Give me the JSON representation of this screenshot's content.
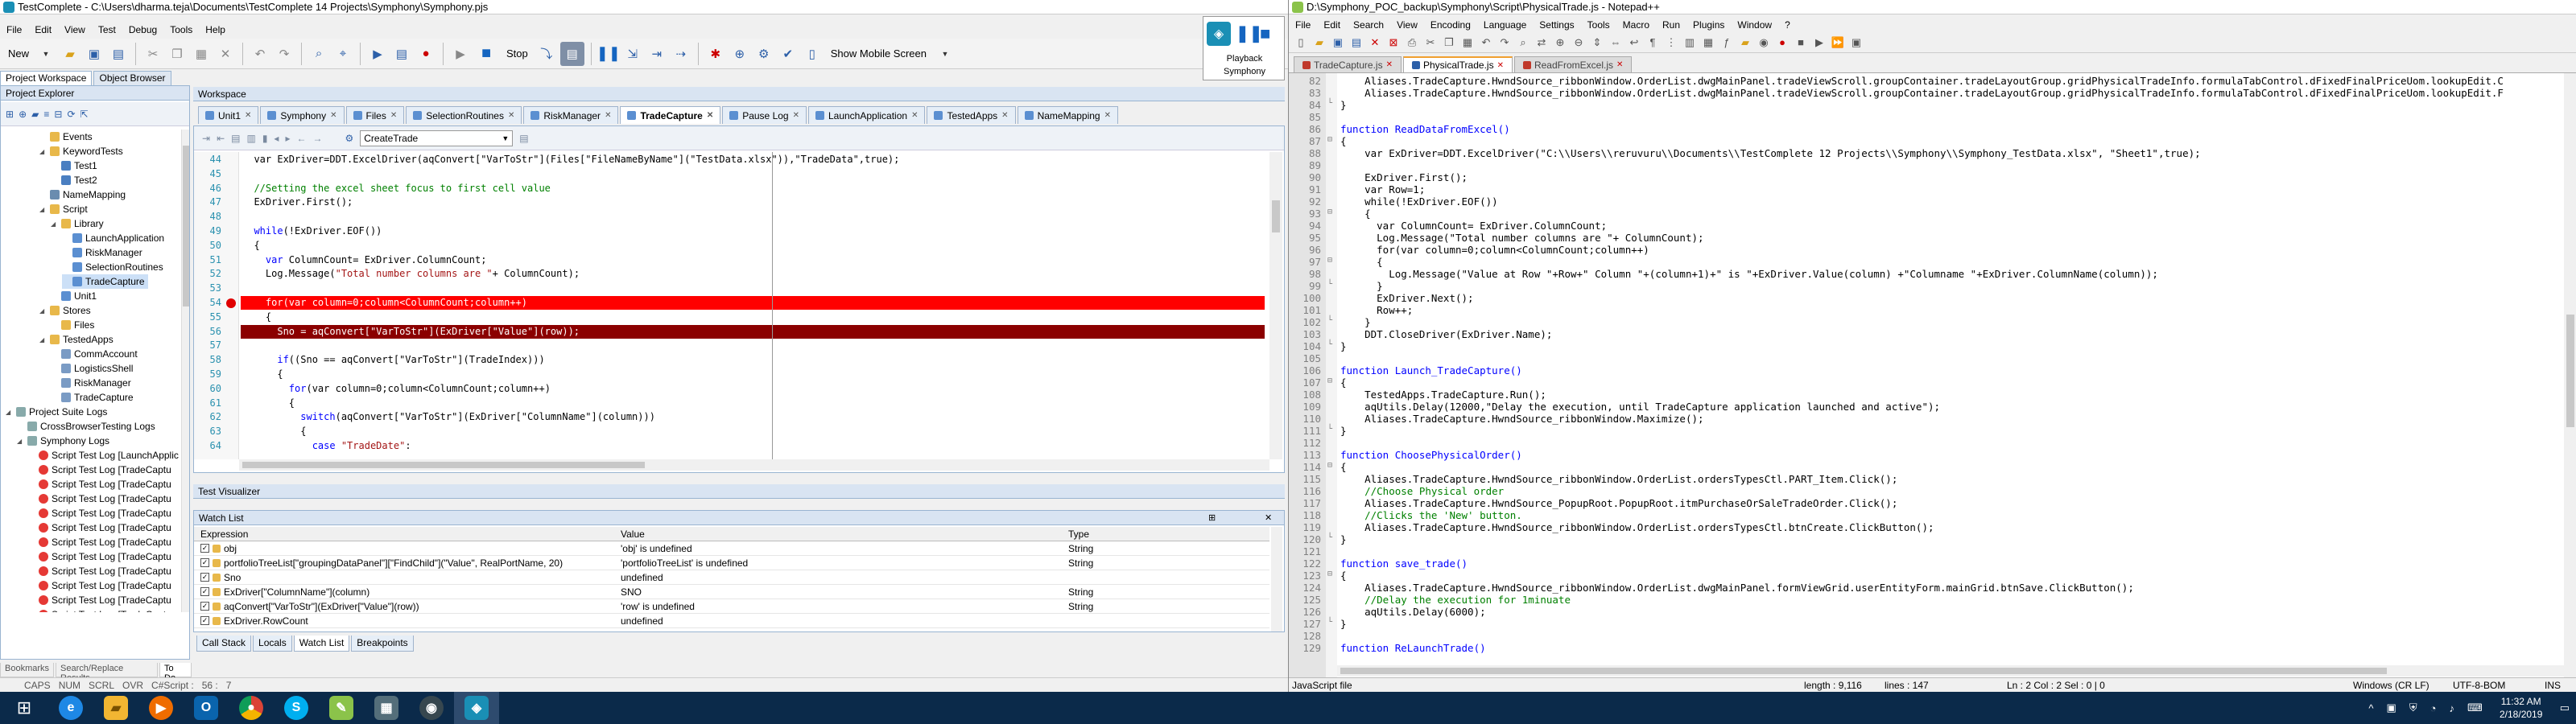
{
  "testcomplete": {
    "title": "TestComplete - C:\\Users\\dharma.teja\\Documents\\TestComplete 14 Projects\\Symphony\\Symphony.pjs",
    "menu": [
      "File",
      "Edit",
      "View",
      "Test",
      "Debug",
      "Tools",
      "Help"
    ],
    "toolbar": {
      "new_label": "New",
      "stop_label": "Stop",
      "mobile_label": "Show Mobile Screen"
    },
    "panels": {
      "project_workspace_tab": "Project Workspace",
      "object_browser_tab": "Object Browser",
      "project_explorer": "Project Explorer",
      "workspace": "Workspace"
    },
    "tree": [
      {
        "label": "Events",
        "depth": 3,
        "icon": "folder"
      },
      {
        "label": "KeywordTests",
        "depth": 3,
        "icon": "folder",
        "expanded": true
      },
      {
        "label": "Test1",
        "depth": 4,
        "icon": "test"
      },
      {
        "label": "Test2",
        "depth": 4,
        "icon": "test"
      },
      {
        "label": "NameMapping",
        "depth": 3,
        "icon": "map"
      },
      {
        "label": "Script",
        "depth": 3,
        "icon": "folder",
        "expanded": true
      },
      {
        "label": "Library",
        "depth": 4,
        "icon": "folder",
        "expanded": true
      },
      {
        "label": "LaunchApplication",
        "depth": 5,
        "icon": "script"
      },
      {
        "label": "RiskManager",
        "depth": 5,
        "icon": "script"
      },
      {
        "label": "SelectionRoutines",
        "depth": 5,
        "icon": "script"
      },
      {
        "label": "TradeCapture",
        "depth": 5,
        "icon": "script",
        "selected": true
      },
      {
        "label": "Unit1",
        "depth": 4,
        "icon": "script"
      },
      {
        "label": "Stores",
        "depth": 3,
        "icon": "folder",
        "expanded": true
      },
      {
        "label": "Files",
        "depth": 4,
        "icon": "folder"
      },
      {
        "label": "TestedApps",
        "depth": 3,
        "icon": "folder",
        "expanded": true
      },
      {
        "label": "CommAccount",
        "depth": 4,
        "icon": "app"
      },
      {
        "label": "LogisticsShell",
        "depth": 4,
        "icon": "app"
      },
      {
        "label": "RiskManager",
        "depth": 4,
        "icon": "app"
      },
      {
        "label": "TradeCapture",
        "depth": 4,
        "icon": "app"
      },
      {
        "label": "Project Suite Logs",
        "depth": 0,
        "icon": "log",
        "expanded": true
      },
      {
        "label": "CrossBrowserTesting Logs",
        "depth": 1,
        "icon": "log"
      },
      {
        "label": "Symphony Logs",
        "depth": 1,
        "icon": "log",
        "expanded": true
      },
      {
        "label": "Script Test Log [LaunchApplic",
        "depth": 2,
        "icon": "error"
      },
      {
        "label": "Script Test Log [TradeCaptu",
        "depth": 2,
        "icon": "error"
      },
      {
        "label": "Script Test Log [TradeCaptu",
        "depth": 2,
        "icon": "error"
      },
      {
        "label": "Script Test Log [TradeCaptu",
        "depth": 2,
        "icon": "error"
      },
      {
        "label": "Script Test Log [TradeCaptu",
        "depth": 2,
        "icon": "error"
      },
      {
        "label": "Script Test Log [TradeCaptu",
        "depth": 2,
        "icon": "error"
      },
      {
        "label": "Script Test Log [TradeCaptu",
        "depth": 2,
        "icon": "error"
      },
      {
        "label": "Script Test Log [TradeCaptu",
        "depth": 2,
        "icon": "error"
      },
      {
        "label": "Script Test Log [TradeCaptu",
        "depth": 2,
        "icon": "error"
      },
      {
        "label": "Script Test Log [TradeCaptu",
        "depth": 2,
        "icon": "error"
      },
      {
        "label": "Script Test Log [TradeCaptu",
        "depth": 2,
        "icon": "error"
      },
      {
        "label": "Script Test Log [TradeCaptu",
        "depth": 2,
        "icon": "error"
      }
    ],
    "bottom_left_tabs": [
      "Bookmarks",
      "Search/Replace Results",
      "To Do"
    ],
    "editor_tabs": [
      {
        "label": "Unit1"
      },
      {
        "label": "Symphony"
      },
      {
        "label": "Files"
      },
      {
        "label": "SelectionRoutines"
      },
      {
        "label": "RiskManager"
      },
      {
        "label": "TradeCapture",
        "active": true
      },
      {
        "label": "Pause Log"
      },
      {
        "label": "LaunchApplication"
      },
      {
        "label": "TestedApps"
      },
      {
        "label": "NameMapping"
      }
    ],
    "routine_dropdown": "CreateTrade",
    "code_lines": [
      {
        "n": "44",
        "segs": [
          [
            "",
            "  var ExDriver=DDT.ExcelDriver(aqConvert[\"VarToStr\"](Files[\"FileNameByName\"](\"TestData.xlsx\")),\"TradeData\",true);"
          ]
        ]
      },
      {
        "n": "45",
        "segs": [
          [
            "",
            ""
          ]
        ]
      },
      {
        "n": "46",
        "segs": [
          [
            "cm",
            "  //Setting the excel sheet focus to first cell value"
          ]
        ]
      },
      {
        "n": "47",
        "segs": [
          [
            "",
            "  ExDriver.First();"
          ]
        ]
      },
      {
        "n": "48",
        "segs": [
          [
            "",
            ""
          ]
        ]
      },
      {
        "n": "49",
        "segs": [
          [
            "kw",
            "  while"
          ],
          [
            "",
            "(!ExDriver.EOF())"
          ]
        ]
      },
      {
        "n": "50",
        "segs": [
          [
            "",
            "  {"
          ]
        ]
      },
      {
        "n": "51",
        "segs": [
          [
            "kw",
            "    var"
          ],
          [
            "",
            " ColumnCount= ExDriver.ColumnCount;"
          ]
        ]
      },
      {
        "n": "52",
        "segs": [
          [
            "",
            "    Log.Message("
          ],
          [
            "st",
            "\"Total number columns are \""
          ],
          [
            "",
            "+ ColumnCount);"
          ]
        ]
      },
      {
        "n": "53",
        "segs": [
          [
            "",
            ""
          ]
        ]
      },
      {
        "n": "54",
        "segs": [
          [
            "",
            "    for(var column=0;column<ColumnCount;column++)"
          ]
        ],
        "breakpoint": true
      },
      {
        "n": "55",
        "segs": [
          [
            "",
            "    {"
          ]
        ]
      },
      {
        "n": "56",
        "segs": [
          [
            "",
            "      Sno = aqConvert[\"VarToStr\"](ExDriver[\"Value\"](row));"
          ]
        ],
        "current": true
      },
      {
        "n": "57",
        "segs": [
          [
            "",
            ""
          ]
        ]
      },
      {
        "n": "58",
        "segs": [
          [
            "kw",
            "      if"
          ],
          [
            "",
            "((Sno == aqConvert[\"VarToStr\"](TradeIndex)))"
          ]
        ]
      },
      {
        "n": "59",
        "segs": [
          [
            "",
            "      {"
          ]
        ]
      },
      {
        "n": "60",
        "segs": [
          [
            "kw",
            "        for"
          ],
          [
            "",
            "(var column=0;column<ColumnCount;column++)"
          ]
        ]
      },
      {
        "n": "61",
        "segs": [
          [
            "",
            "        {"
          ]
        ]
      },
      {
        "n": "62",
        "segs": [
          [
            "kw",
            "          switch"
          ],
          [
            "",
            "(aqConvert[\"VarToStr\"](ExDriver[\"ColumnName\"](column)))"
          ]
        ]
      },
      {
        "n": "63",
        "segs": [
          [
            "",
            "          {"
          ]
        ]
      },
      {
        "n": "64",
        "segs": [
          [
            "kw",
            "            case"
          ],
          [
            "",
            " "
          ],
          [
            "st",
            "\"TradeDate\""
          ],
          [
            "",
            ":"
          ]
        ]
      }
    ],
    "test_visualizer_label": "Test Visualizer",
    "watch_list": {
      "title": "Watch List",
      "columns": [
        "Expression",
        "Value",
        "Type"
      ],
      "rows": [
        {
          "expression": "obj",
          "value": "'obj' is undefined",
          "type": "String"
        },
        {
          "expression": "portfolioTreeList[\"groupingDataPanel\"][\"FindChild\"](\"Value\", RealPortName, 20)",
          "value": "'portfolioTreeList' is undefined",
          "type": "String"
        },
        {
          "expression": "Sno",
          "value": "undefined",
          "type": ""
        },
        {
          "expression": "ExDriver[\"ColumnName\"](column)",
          "value": "SNO",
          "type": "String"
        },
        {
          "expression": "aqConvert[\"VarToStr\"](ExDriver[\"Value\"](row))",
          "value": "'row' is undefined",
          "type": "String"
        },
        {
          "expression": "ExDriver.RowCount",
          "value": "undefined",
          "type": ""
        }
      ]
    },
    "bottom_tabs": [
      {
        "label": "Call Stack"
      },
      {
        "label": "Locals"
      },
      {
        "label": "Watch List",
        "active": true
      },
      {
        "label": "Breakpoints"
      }
    ],
    "status": [
      "CAPS",
      "NUM",
      "SCRL",
      "OVR",
      "C#Script :",
      "56 :",
      "7"
    ]
  },
  "playback": {
    "line1": "Playback",
    "line2": "Symphony"
  },
  "notepad": {
    "title": "D:\\Symphony_POC_backup\\Symphony\\Script\\PhysicalTrade.js - Notepad++",
    "menu": [
      "File",
      "Edit",
      "Search",
      "View",
      "Encoding",
      "Language",
      "Settings",
      "Tools",
      "Macro",
      "Run",
      "Plugins",
      "Window",
      "?"
    ],
    "tabs": [
      {
        "label": "TradeCapture.js"
      },
      {
        "label": "PhysicalTrade.js",
        "active": true
      },
      {
        "label": "ReadFromExcel.js"
      }
    ],
    "lines": [
      {
        "n": "82",
        "t": "    Aliases.TradeCapture.HwndSource_ribbonWindow.OrderList.dwgMainPanel.tradeViewScroll.groupContainer.tradeLayoutGroup.gridPhysicalTradeInfo.formulaTabControl.dFixedFinalPriceUom.lookupEdit.C"
      },
      {
        "n": "83",
        "t": "    Aliases.TradeCapture.HwndSource_ribbonWindow.OrderList.dwgMainPanel.tradeViewScroll.groupContainer.tradeLayoutGroup.gridPhysicalTradeInfo.formulaTabControl.dFixedFinalPriceUom.lookupEdit.F"
      },
      {
        "n": "84",
        "t": "}",
        "fold": "end"
      },
      {
        "n": "85",
        "t": ""
      },
      {
        "n": "86",
        "t": "function ReadDataFromExcel()",
        "kw": true
      },
      {
        "n": "87",
        "t": "{",
        "fold": "open"
      },
      {
        "n": "88",
        "t": "    var ExDriver=DDT.ExcelDriver(\"C:\\\\Users\\\\reruvuru\\\\Documents\\\\TestComplete 12 Projects\\\\Symphony\\\\Symphony_TestData.xlsx\", \"Sheet1\",true);"
      },
      {
        "n": "89",
        "t": ""
      },
      {
        "n": "90",
        "t": "    ExDriver.First();"
      },
      {
        "n": "91",
        "t": "    var Row=1;"
      },
      {
        "n": "92",
        "t": "    while(!ExDriver.EOF())"
      },
      {
        "n": "93",
        "t": "    {",
        "fold": "open"
      },
      {
        "n": "94",
        "t": "      var ColumnCount= ExDriver.ColumnCount;"
      },
      {
        "n": "95",
        "t": "      Log.Message(\"Total number columns are \"+ ColumnCount);"
      },
      {
        "n": "96",
        "t": "      for(var column=0;column<ColumnCount;column++)"
      },
      {
        "n": "97",
        "t": "      {",
        "fold": "open"
      },
      {
        "n": "98",
        "t": "        Log.Message(\"Value at Row \"+Row+\" Column \"+(column+1)+\" is \"+ExDriver.Value(column) +\"Columname \"+ExDriver.ColumnName(column));"
      },
      {
        "n": "99",
        "t": "      }",
        "fold": "end"
      },
      {
        "n": "100",
        "t": "      ExDriver.Next();"
      },
      {
        "n": "101",
        "t": "      Row++;"
      },
      {
        "n": "102",
        "t": "    }",
        "fold": "end"
      },
      {
        "n": "103",
        "t": "    DDT.CloseDriver(ExDriver.Name);"
      },
      {
        "n": "104",
        "t": "}",
        "fold": "end"
      },
      {
        "n": "105",
        "t": ""
      },
      {
        "n": "106",
        "t": "function Launch_TradeCapture()",
        "kw": true
      },
      {
        "n": "107",
        "t": "{",
        "fold": "open"
      },
      {
        "n": "108",
        "t": "    TestedApps.TradeCapture.Run();"
      },
      {
        "n": "109",
        "t": "    aqUtils.Delay(12000,\"Delay the execution, until TradeCapture application launched and active\");"
      },
      {
        "n": "110",
        "t": "    Aliases.TradeCapture.HwndSource_ribbonWindow.Maximize();"
      },
      {
        "n": "111",
        "t": "}",
        "fold": "end"
      },
      {
        "n": "112",
        "t": ""
      },
      {
        "n": "113",
        "t": "function ChoosePhysicalOrder()",
        "kw": true
      },
      {
        "n": "114",
        "t": "{",
        "fold": "open"
      },
      {
        "n": "115",
        "t": "    Aliases.TradeCapture.HwndSource_ribbonWindow.OrderList.ordersTypesCtl.PART_Item.Click();"
      },
      {
        "n": "116",
        "t": "    //Choose Physical order",
        "comment": true
      },
      {
        "n": "117",
        "t": "    Aliases.TradeCapture.HwndSource_PopupRoot.PopupRoot.itmPurchaseOrSaleTradeOrder.Click();"
      },
      {
        "n": "118",
        "t": "    //Clicks the 'New' button.",
        "comment": true
      },
      {
        "n": "119",
        "t": "    Aliases.TradeCapture.HwndSource_ribbonWindow.OrderList.ordersTypesCtl.btnCreate.ClickButton();"
      },
      {
        "n": "120",
        "t": "}",
        "fold": "end"
      },
      {
        "n": "121",
        "t": ""
      },
      {
        "n": "122",
        "t": "function save_trade()",
        "kw": true
      },
      {
        "n": "123",
        "t": "{",
        "fold": "open"
      },
      {
        "n": "124",
        "t": "    Aliases.TradeCapture.HwndSource_ribbonWindow.OrderList.dwgMainPanel.formViewGrid.userEntityForm.mainGrid.btnSave.ClickButton();"
      },
      {
        "n": "125",
        "t": "    //Delay the execution for 1minuate",
        "comment": true
      },
      {
        "n": "126",
        "t": "    aqUtils.Delay(6000);"
      },
      {
        "n": "127",
        "t": "}",
        "fold": "end"
      },
      {
        "n": "128",
        "t": ""
      },
      {
        "n": "129",
        "t": "function ReLaunchTrade()",
        "kw": true
      }
    ],
    "status": {
      "filetype": "JavaScript file",
      "length": "length : 9,116",
      "lines": "lines : 147",
      "pos": "Ln : 2   Col : 2   Sel : 0 | 0",
      "eol": "Windows (CR LF)",
      "encoding": "UTF-8-BOM",
      "mode": "INS"
    }
  },
  "taskbar": {
    "time": "11:32 AM",
    "date": "2/18/2019"
  },
  "colors": {
    "breakpoint": "#ff0000",
    "current_line": "#8b0000",
    "taskbar": "#0b2a4a",
    "npp_keyword": "#0000ff",
    "npp_comment": "#008000"
  }
}
